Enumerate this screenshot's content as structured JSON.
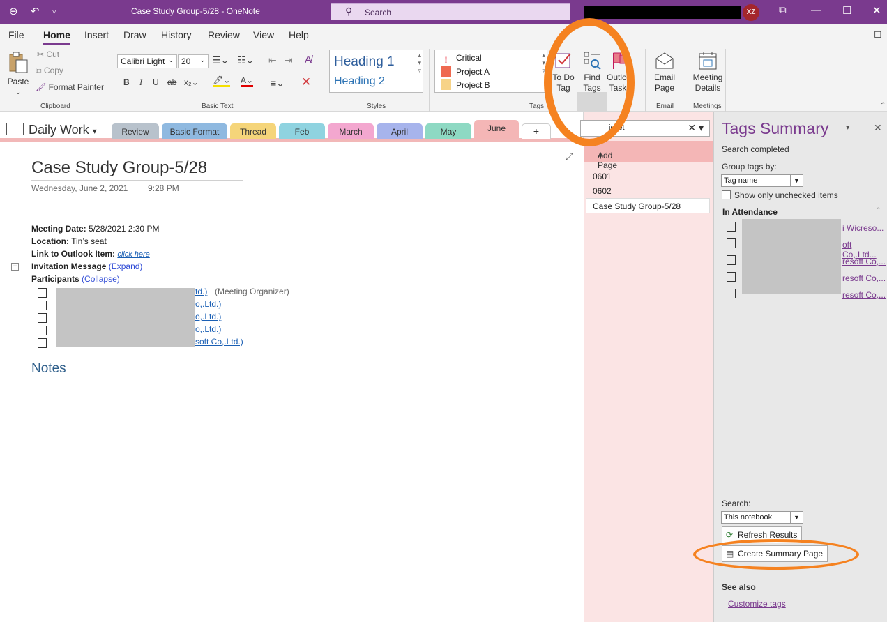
{
  "titlebar": {
    "back_icon": "back-arrow-icon",
    "undo_icon": "undo-icon",
    "title": "Case Study Group-5/28  -  OneNote",
    "search_placeholder": "Search",
    "avatar_initials": "XZ"
  },
  "menu": {
    "tabs": [
      "File",
      "Home",
      "Insert",
      "Draw",
      "History",
      "Review",
      "View",
      "Help"
    ],
    "active": "Home"
  },
  "ribbon": {
    "clipboard": {
      "paste": "Paste",
      "cut": "Cut",
      "copy": "Copy",
      "format_painter": "Format Painter",
      "label": "Clipboard"
    },
    "basic_text": {
      "font": "Calibri Light",
      "size": "20",
      "label": "Basic Text"
    },
    "styles": {
      "heading1": "Heading 1",
      "heading2": "Heading 2",
      "label": "Styles"
    },
    "tags": {
      "items": [
        {
          "label": "Critical",
          "color": "#e81123"
        },
        {
          "label": "Project A",
          "color": "#ef6950"
        },
        {
          "label": "Project B",
          "color": "#f7d387"
        }
      ],
      "todo": "To Do Tag",
      "find": "Find Tags",
      "outlook": "Outlook Tasks",
      "label": "Tags"
    },
    "email": {
      "button": "Email Page",
      "label": "Email"
    },
    "meetings": {
      "button": "Meeting Details",
      "label": "Meetings"
    }
  },
  "notebook": {
    "name": "Daily Work",
    "sections": [
      {
        "label": "Review",
        "color": "#b8c2cc"
      },
      {
        "label": "Basic Format",
        "color": "#8fb9e0"
      },
      {
        "label": "Thread",
        "color": "#f5d57a"
      },
      {
        "label": "Feb",
        "color": "#8fd3e0"
      },
      {
        "label": "March",
        "color": "#f3a7cf"
      },
      {
        "label": "April",
        "color": "#a7b4ec"
      },
      {
        "label": "May",
        "color": "#8ed9c3"
      },
      {
        "label": "June",
        "color": "#f4b6b6"
      },
      {
        "label": "+",
        "color": "#ffffff"
      }
    ]
  },
  "page": {
    "title": "Case Study Group-5/28",
    "date": "Wednesday, June 2, 2021",
    "time": "9:28 PM",
    "meeting_date_label": "Meeting Date:",
    "meeting_date_value": "5/28/2021 2:30 PM",
    "location_label": "Location:",
    "location_value": "Tin’s seat",
    "link_label": "Link to Outlook Item:",
    "link_value": "click here",
    "invitation_label": "Invitation Message",
    "invitation_toggle": "(Expand)",
    "participants_label": "Participants",
    "participants_toggle": "(Collapse)",
    "participants": [
      {
        "visible_link": "td.)",
        "note": "(Meeting Organizer)"
      },
      {
        "visible_link": "o,.Ltd.)",
        "note": ""
      },
      {
        "visible_link": "o,.Ltd.)",
        "note": ""
      },
      {
        "visible_link": "o,.Ltd.)",
        "note": ""
      },
      {
        "visible_link": "soft Co,.Ltd.)",
        "note": ""
      }
    ],
    "notes_heading": "Notes"
  },
  "page_list": {
    "search_value": "icket",
    "add_page": "Add Page",
    "pages": [
      "0601",
      "0602",
      "Case Study Group-5/28"
    ]
  },
  "tags_summary": {
    "title": "Tags Summary",
    "status": "Search completed",
    "group_by_label": "Group tags by:",
    "group_by_value": "Tag name",
    "show_unchecked": "Show only unchecked items",
    "group_name": "In Attendance",
    "results": [
      "i Wicreso...",
      "oft Co,.Ltd...",
      "resoft Co,...",
      "resoft Co,...",
      "resoft Co,..."
    ],
    "search_label": "Search:",
    "search_scope": "This notebook",
    "refresh": "Refresh Results",
    "create_summary": "Create Summary Page",
    "see_also": "See also",
    "customize": "Customize tags"
  }
}
